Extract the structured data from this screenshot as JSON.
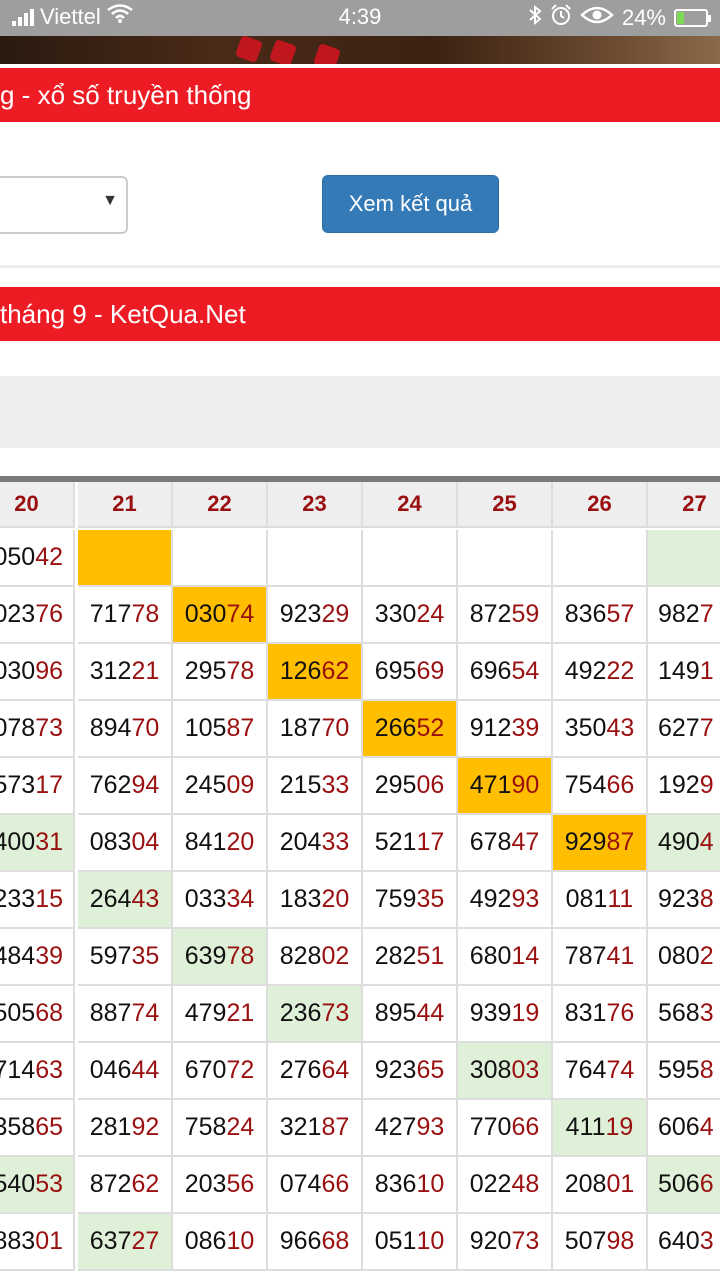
{
  "status_bar": {
    "carrier": "Viettel",
    "time": "4:39",
    "battery": "24%",
    "battery_level": 0.24
  },
  "header": {
    "title_1": "g - xổ số truyền thống",
    "title_2": "tháng 9 - KetQua.Net"
  },
  "form": {
    "view_button": "Xem kết quả"
  },
  "table": {
    "columns": [
      "20",
      "21",
      "22",
      "23",
      "24",
      "25",
      "26",
      "27"
    ],
    "rows": [
      [
        {
          "h": "050",
          "t": "42",
          "bg": ""
        },
        {
          "h": "",
          "t": "",
          "bg": "orange"
        },
        {
          "h": "",
          "t": "",
          "bg": ""
        },
        {
          "h": "",
          "t": "",
          "bg": ""
        },
        {
          "h": "",
          "t": "",
          "bg": ""
        },
        {
          "h": "",
          "t": "",
          "bg": ""
        },
        {
          "h": "",
          "t": "",
          "bg": ""
        },
        {
          "h": "",
          "t": "",
          "bg": "green"
        }
      ],
      [
        {
          "h": "023",
          "t": "76",
          "bg": ""
        },
        {
          "h": "717",
          "t": "78",
          "bg": ""
        },
        {
          "h": "030",
          "t": "74",
          "bg": "orange"
        },
        {
          "h": "923",
          "t": "29",
          "bg": ""
        },
        {
          "h": "330",
          "t": "24",
          "bg": ""
        },
        {
          "h": "872",
          "t": "59",
          "bg": ""
        },
        {
          "h": "836",
          "t": "57",
          "bg": ""
        },
        {
          "h": "982",
          "t": "7",
          "bg": ""
        }
      ],
      [
        {
          "h": "030",
          "t": "96",
          "bg": ""
        },
        {
          "h": "312",
          "t": "21",
          "bg": ""
        },
        {
          "h": "295",
          "t": "78",
          "bg": ""
        },
        {
          "h": "126",
          "t": "62",
          "bg": "orange"
        },
        {
          "h": "695",
          "t": "69",
          "bg": ""
        },
        {
          "h": "696",
          "t": "54",
          "bg": ""
        },
        {
          "h": "492",
          "t": "22",
          "bg": ""
        },
        {
          "h": "149",
          "t": "1",
          "bg": ""
        }
      ],
      [
        {
          "h": "078",
          "t": "73",
          "bg": ""
        },
        {
          "h": "894",
          "t": "70",
          "bg": ""
        },
        {
          "h": "105",
          "t": "87",
          "bg": ""
        },
        {
          "h": "187",
          "t": "70",
          "bg": ""
        },
        {
          "h": "266",
          "t": "52",
          "bg": "orange"
        },
        {
          "h": "912",
          "t": "39",
          "bg": ""
        },
        {
          "h": "350",
          "t": "43",
          "bg": ""
        },
        {
          "h": "627",
          "t": "7",
          "bg": ""
        }
      ],
      [
        {
          "h": "573",
          "t": "17",
          "bg": ""
        },
        {
          "h": "762",
          "t": "94",
          "bg": ""
        },
        {
          "h": "245",
          "t": "09",
          "bg": ""
        },
        {
          "h": "215",
          "t": "33",
          "bg": ""
        },
        {
          "h": "295",
          "t": "06",
          "bg": ""
        },
        {
          "h": "471",
          "t": "90",
          "bg": "orange"
        },
        {
          "h": "754",
          "t": "66",
          "bg": ""
        },
        {
          "h": "192",
          "t": "9",
          "bg": ""
        }
      ],
      [
        {
          "h": "400",
          "t": "31",
          "bg": "green"
        },
        {
          "h": "083",
          "t": "04",
          "bg": ""
        },
        {
          "h": "841",
          "t": "20",
          "bg": ""
        },
        {
          "h": "204",
          "t": "33",
          "bg": ""
        },
        {
          "h": "521",
          "t": "17",
          "bg": ""
        },
        {
          "h": "678",
          "t": "47",
          "bg": ""
        },
        {
          "h": "929",
          "t": "87",
          "bg": "orange"
        },
        {
          "h": "490",
          "t": "4",
          "bg": "green"
        }
      ],
      [
        {
          "h": "233",
          "t": "15",
          "bg": ""
        },
        {
          "h": "264",
          "t": "43",
          "bg": "green"
        },
        {
          "h": "033",
          "t": "34",
          "bg": ""
        },
        {
          "h": "183",
          "t": "20",
          "bg": ""
        },
        {
          "h": "759",
          "t": "35",
          "bg": ""
        },
        {
          "h": "492",
          "t": "93",
          "bg": ""
        },
        {
          "h": "081",
          "t": "11",
          "bg": ""
        },
        {
          "h": "923",
          "t": "8",
          "bg": ""
        }
      ],
      [
        {
          "h": "484",
          "t": "39",
          "bg": ""
        },
        {
          "h": "597",
          "t": "35",
          "bg": ""
        },
        {
          "h": "639",
          "t": "78",
          "bg": "green"
        },
        {
          "h": "828",
          "t": "02",
          "bg": ""
        },
        {
          "h": "282",
          "t": "51",
          "bg": ""
        },
        {
          "h": "680",
          "t": "14",
          "bg": ""
        },
        {
          "h": "787",
          "t": "41",
          "bg": ""
        },
        {
          "h": "080",
          "t": "2",
          "bg": ""
        }
      ],
      [
        {
          "h": "505",
          "t": "68",
          "bg": ""
        },
        {
          "h": "887",
          "t": "74",
          "bg": ""
        },
        {
          "h": "479",
          "t": "21",
          "bg": ""
        },
        {
          "h": "236",
          "t": "73",
          "bg": "green"
        },
        {
          "h": "895",
          "t": "44",
          "bg": ""
        },
        {
          "h": "939",
          "t": "19",
          "bg": ""
        },
        {
          "h": "831",
          "t": "76",
          "bg": ""
        },
        {
          "h": "568",
          "t": "3",
          "bg": ""
        }
      ],
      [
        {
          "h": "714",
          "t": "63",
          "bg": ""
        },
        {
          "h": "046",
          "t": "44",
          "bg": ""
        },
        {
          "h": "670",
          "t": "72",
          "bg": ""
        },
        {
          "h": "276",
          "t": "64",
          "bg": ""
        },
        {
          "h": "923",
          "t": "65",
          "bg": ""
        },
        {
          "h": "308",
          "t": "03",
          "bg": "green"
        },
        {
          "h": "764",
          "t": "74",
          "bg": ""
        },
        {
          "h": "595",
          "t": "8",
          "bg": ""
        }
      ],
      [
        {
          "h": "358",
          "t": "65",
          "bg": ""
        },
        {
          "h": "281",
          "t": "92",
          "bg": ""
        },
        {
          "h": "758",
          "t": "24",
          "bg": ""
        },
        {
          "h": "321",
          "t": "87",
          "bg": ""
        },
        {
          "h": "427",
          "t": "93",
          "bg": ""
        },
        {
          "h": "770",
          "t": "66",
          "bg": ""
        },
        {
          "h": "411",
          "t": "19",
          "bg": "green"
        },
        {
          "h": "606",
          "t": "4",
          "bg": ""
        }
      ],
      [
        {
          "h": "540",
          "t": "53",
          "bg": "green"
        },
        {
          "h": "872",
          "t": "62",
          "bg": ""
        },
        {
          "h": "203",
          "t": "56",
          "bg": ""
        },
        {
          "h": "074",
          "t": "66",
          "bg": ""
        },
        {
          "h": "836",
          "t": "10",
          "bg": ""
        },
        {
          "h": "022",
          "t": "48",
          "bg": ""
        },
        {
          "h": "208",
          "t": "01",
          "bg": ""
        },
        {
          "h": "506",
          "t": "6",
          "bg": "green"
        }
      ],
      [
        {
          "h": "883",
          "t": "01",
          "bg": ""
        },
        {
          "h": "637",
          "t": "27",
          "bg": "green"
        },
        {
          "h": "086",
          "t": "10",
          "bg": ""
        },
        {
          "h": "966",
          "t": "68",
          "bg": ""
        },
        {
          "h": "051",
          "t": "10",
          "bg": ""
        },
        {
          "h": "920",
          "t": "73",
          "bg": ""
        },
        {
          "h": "507",
          "t": "98",
          "bg": ""
        },
        {
          "h": "640",
          "t": "3",
          "bg": ""
        }
      ]
    ]
  }
}
